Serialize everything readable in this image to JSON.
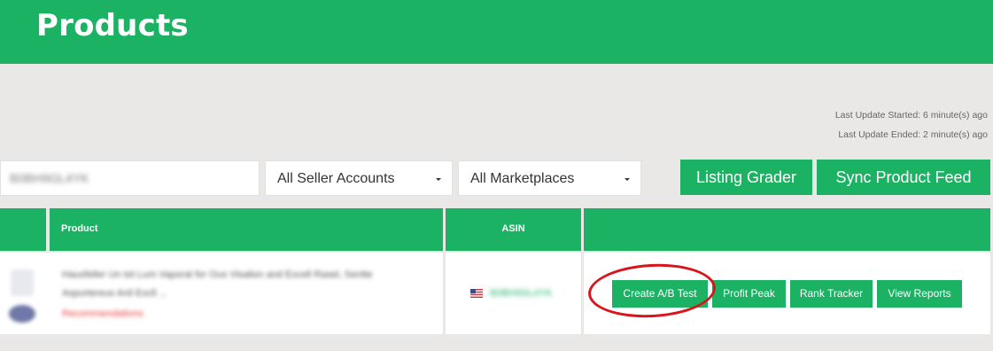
{
  "header": {
    "title": "Products",
    "color": "#1bb264"
  },
  "status": {
    "last_update_started": "Last Update Started: 6 minute(s) ago",
    "last_update_ended": "Last Update Ended: 2 minute(s) ago"
  },
  "filters": {
    "search_value": "B0BH9GL4YK",
    "seller_accounts": "All Seller Accounts",
    "marketplaces": "All Marketplaces"
  },
  "toolbar": {
    "listing_grader": "Listing Grader",
    "sync_product_feed": "Sync Product Feed"
  },
  "table": {
    "headers": {
      "product": "Product",
      "asin": "ASIN",
      "actions": ""
    },
    "rows": [
      {
        "product_title_line1": "Hausfeller Un tot Lum Vaporat for Ous Visalion and Excell Rasel, Sentte",
        "product_title_line2": "Aspurtereus Anil Excll ...",
        "recommendation": "Recommendations",
        "flag_icon": "us-flag-icon",
        "asin": "B0BH9GL4YK",
        "actions": {
          "create_ab_test": "Create A/B Test",
          "profit_peak": "Profit Peak",
          "rank_tracker": "Rank Tracker",
          "view_reports": "View Reports"
        }
      }
    ]
  },
  "annotation": {
    "highlight_color": "#d9141a"
  }
}
